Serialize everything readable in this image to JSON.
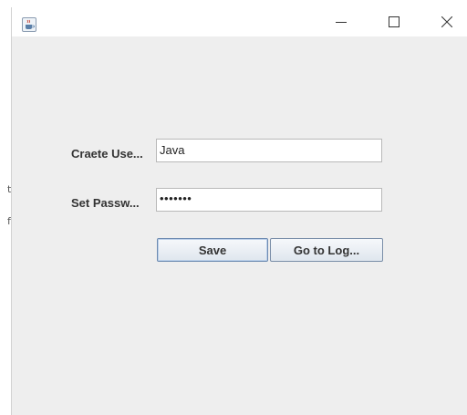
{
  "window": {
    "icon": "java-cup-icon",
    "controls": {
      "minimize": "minimize-icon",
      "maximize": "maximize-icon",
      "close": "close-icon"
    }
  },
  "form": {
    "username_label": "Craete Use...",
    "username_value": "Java",
    "password_label": "Set Passw...",
    "password_masked": "•••••••"
  },
  "buttons": {
    "save_label": "Save",
    "login_label": "Go to Log..."
  },
  "colors": {
    "window_bg": "#eeeeee",
    "field_border": "#b9b9b9",
    "button_border": "#7a8ea8"
  }
}
